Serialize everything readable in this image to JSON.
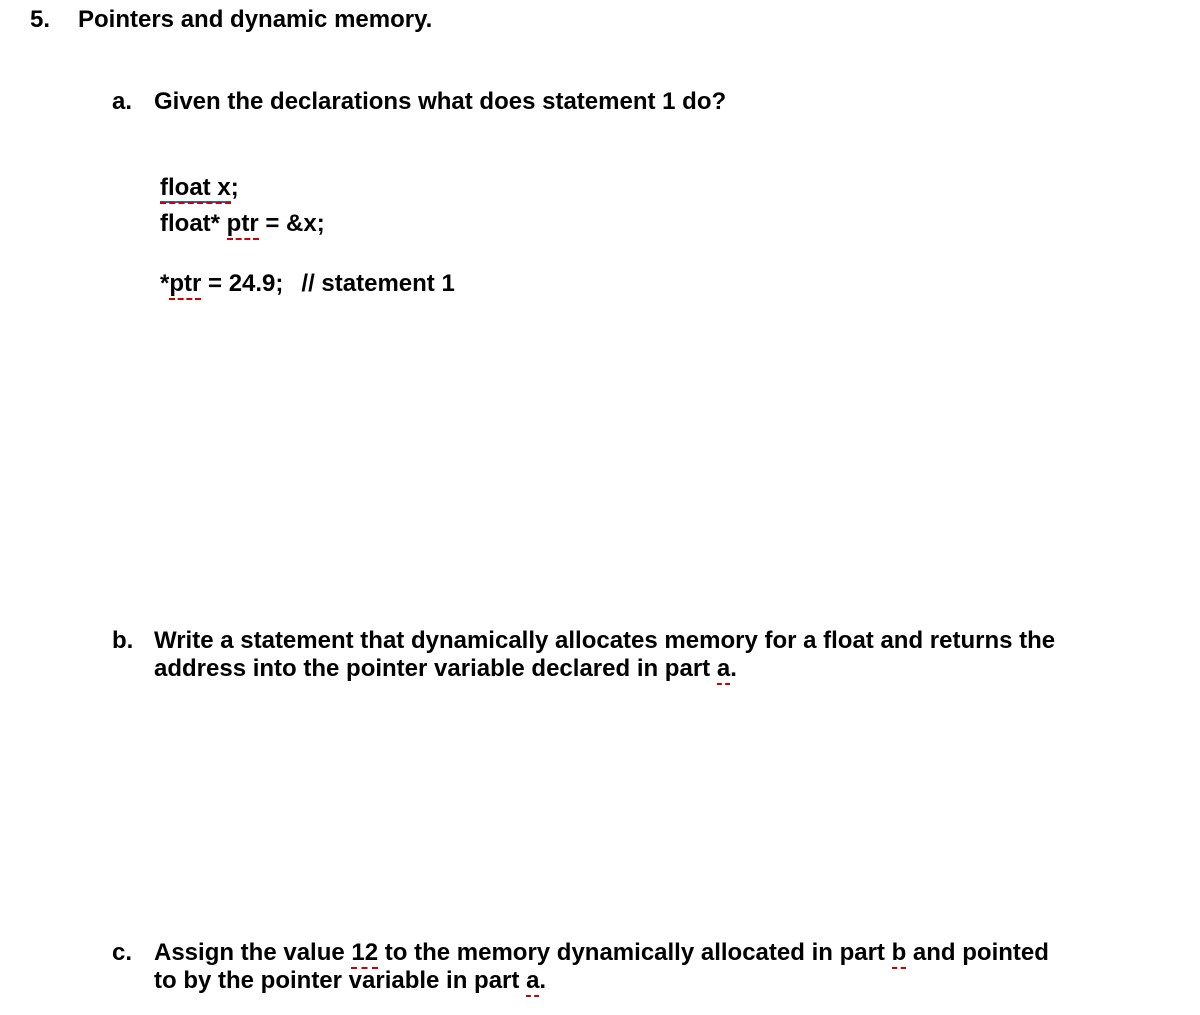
{
  "question": {
    "number": "5.",
    "title": "Pointers and dynamic memory."
  },
  "parts": {
    "a": {
      "letter": "a.",
      "prompt": "Given the declarations what does statement 1 do?"
    },
    "b": {
      "letter": "b.",
      "prompt_l1": "Write a statement that dynamically allocates memory for a float and returns the",
      "prompt_l2_pre": "address into the pointer variable declared in part ",
      "prompt_l2_ul": "a",
      "prompt_l2_post": "."
    },
    "c": {
      "letter": "c.",
      "prompt_l1_pre": "Assign the value ",
      "prompt_l1_ul1": "12",
      "prompt_l1_mid": " to the memory dynamically allocated in part ",
      "prompt_l1_ul2": "b",
      "prompt_l1_post": " and pointed",
      "prompt_l2_pre": "to by the pointer variable in part ",
      "prompt_l2_ul": "a",
      "prompt_l2_post": "."
    }
  },
  "code": {
    "line1_ul": "float  x",
    "line1_post": ";",
    "line2_pre": "float* ",
    "line2_ul": "ptr",
    "line2_post": " = &x;",
    "line3_pre": "*",
    "line3_ul": "ptr",
    "line3_post": " = 24.9;",
    "line3_comment": "// statement 1"
  }
}
